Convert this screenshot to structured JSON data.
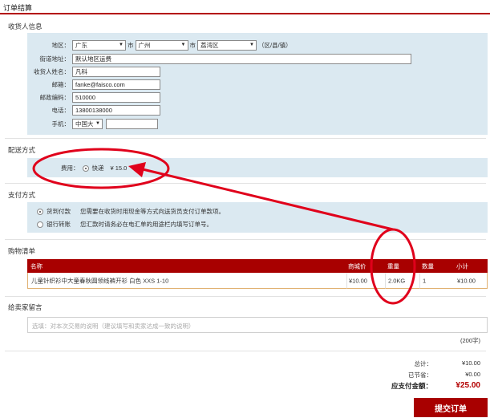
{
  "page_title": "订单结算",
  "receiver": {
    "title": "收货人信息",
    "region": {
      "label": "地区：",
      "province": "广东",
      "city_prefix": "市",
      "city": "广州",
      "district_prefix": "市",
      "district": "荔湾区",
      "suffix": "（区/县/镇）"
    },
    "street": {
      "label": "街道地址：",
      "value": "默认地区运费"
    },
    "name": {
      "label": "收货人姓名：",
      "value": "凡科"
    },
    "email": {
      "label": "邮箱：",
      "value": "fanke@faisco.com"
    },
    "postcode": {
      "label": "邮政编码：",
      "value": "510000"
    },
    "phone": {
      "label": "电话：",
      "value": "13800138000"
    },
    "mobile": {
      "label": "手机：",
      "country": "中国大",
      "value": ""
    }
  },
  "shipping": {
    "title": "配送方式",
    "fee_label": "费用：",
    "option": "快递",
    "price": "¥ 15.0"
  },
  "payment": {
    "title": "支付方式",
    "options": [
      {
        "name": "货到付款",
        "desc": "您需要在收货时用现金等方式向送货员支付订单款项。",
        "checked": true
      },
      {
        "name": "银行转账",
        "desc": "您汇款时请务必在电汇单的用途栏内填写订单号。",
        "checked": false
      }
    ]
  },
  "cart": {
    "title": "购物清单",
    "headers": {
      "name": "名称",
      "price": "商城价",
      "weight": "重量",
      "qty": "数量",
      "subtotal": "小计"
    },
    "items": [
      {
        "name": "儿童针织衫中大童春秋圆领线裤开衫 白色 XXS 1-10",
        "price": "¥10.00",
        "weight": "2.0KG",
        "qty": "1",
        "subtotal": "¥10.00"
      }
    ]
  },
  "memo": {
    "title": "给卖家留言",
    "placeholder": "选填：对本次交易的说明（建议填写和卖家达成一致的说明）",
    "count": "(200字)"
  },
  "summary": {
    "total_label": "总计：",
    "total_value": "¥10.00",
    "saved_label": "已节省：",
    "saved_value": "¥0.00",
    "payable_label": "应支付金额：",
    "payable_value": "¥25.00"
  },
  "submit_label": "提交订单",
  "colors": {
    "accent": "#a80000",
    "panel": "#dbe9f1",
    "annotation": "#e0001b"
  }
}
